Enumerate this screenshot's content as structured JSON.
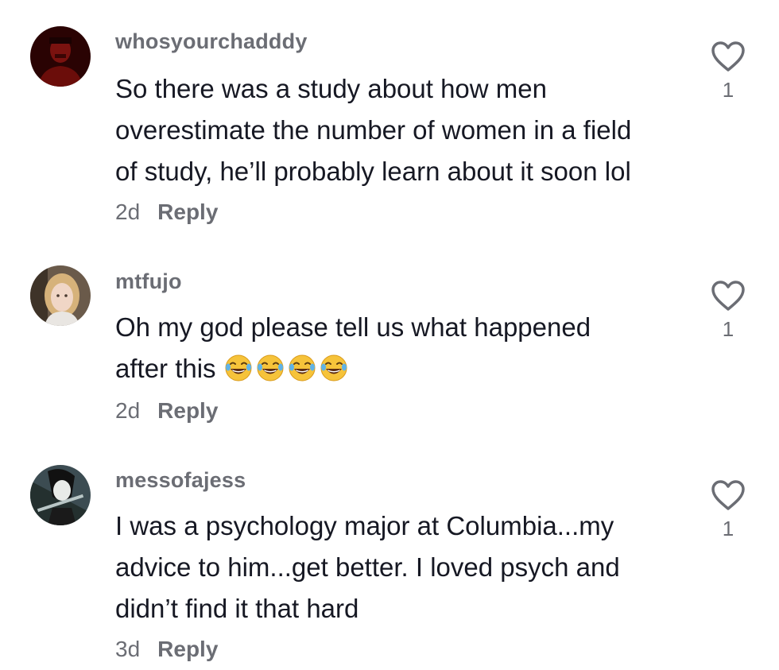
{
  "comments": [
    {
      "username": "whosyourchadddy",
      "text_lines": [
        "So there was a study about how men",
        "overestimate the number of women in a field",
        "of study, he’ll probably learn about it soon lol"
      ],
      "time": "2d",
      "reply_label": "Reply",
      "like_icon": "heart-outline-icon",
      "likes": "1"
    },
    {
      "username": "mtfujo",
      "text_lines": [
        "Oh my god please tell us what happened",
        "after this"
      ],
      "emoji_icon": "face-with-tears-of-joy-emoji",
      "emoji_count": 4,
      "time": "2d",
      "reply_label": "Reply",
      "like_icon": "heart-outline-icon",
      "likes": "1"
    },
    {
      "username": "messofajess",
      "text_lines": [
        "I was a psychology major at Columbia...my",
        "advice to him...get better. I loved psych and",
        "didn’t find it that hard"
      ],
      "time": "3d",
      "reply_label": "Reply",
      "like_icon": "heart-outline-icon",
      "likes": "1"
    }
  ],
  "colors": {
    "text": "#161823",
    "secondary": "#6b6d74"
  }
}
